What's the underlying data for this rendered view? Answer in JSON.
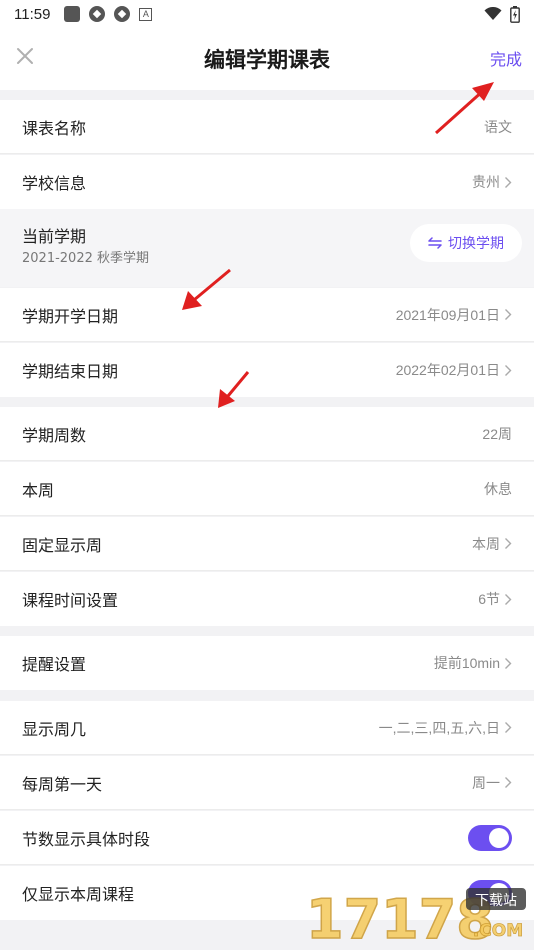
{
  "status_bar": {
    "time": "11:59",
    "notification_letter": "A"
  },
  "header": {
    "title": "编辑学期课表",
    "done_label": "完成"
  },
  "rows": {
    "schedule_name": {
      "label": "课表名称",
      "value": "语文"
    },
    "school_info": {
      "label": "学校信息",
      "value": "贵州"
    },
    "current_term": {
      "label": "当前学期",
      "sub": "2021-2022 秋季学期",
      "switch_label": "切换学期"
    },
    "term_start": {
      "label": "学期开学日期",
      "value": "2021年09月01日"
    },
    "term_end": {
      "label": "学期结束日期",
      "value": "2022年02月01日"
    },
    "term_weeks": {
      "label": "学期周数",
      "value": "22周"
    },
    "this_week": {
      "label": "本周",
      "value": "休息"
    },
    "fixed_week": {
      "label": "固定显示周",
      "value": "本周"
    },
    "class_time": {
      "label": "课程时间设置",
      "value": "6节"
    },
    "reminder": {
      "label": "提醒设置",
      "value": "提前10min"
    },
    "weekdays": {
      "label": "显示周几",
      "value": "一,二,三,四,五,六,日"
    },
    "first_day": {
      "label": "每周第一天",
      "value": "周一"
    },
    "show_periods": {
      "label": "节数显示具体时段",
      "enabled": true
    },
    "only_this_week": {
      "label": "仅显示本周课程",
      "enabled": true
    }
  },
  "watermark": {
    "digits": "17178",
    "badge": "下载站",
    "domain": ".COM"
  },
  "colors": {
    "accent": "#6c4ff0",
    "annotation_arrow": "#e02020"
  }
}
